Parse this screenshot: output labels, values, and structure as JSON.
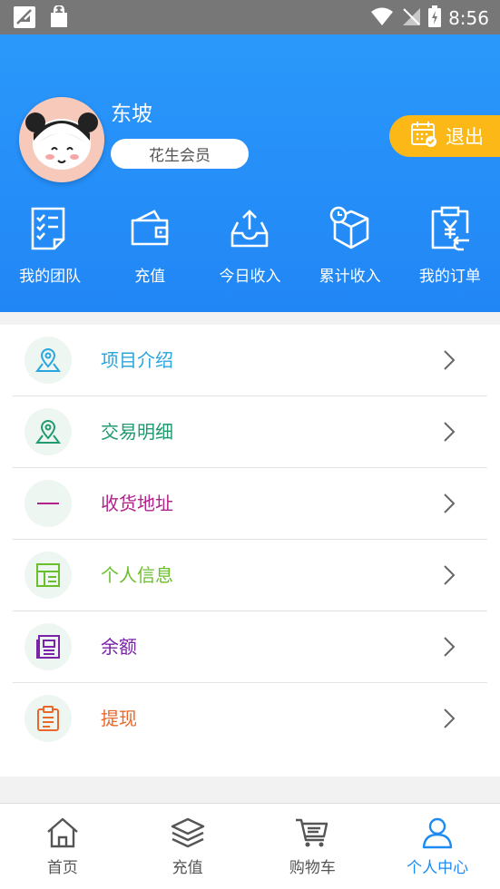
{
  "status_bar": {
    "time": "8:56",
    "icons": [
      "no-sim-image-icon",
      "shopping-bag-icon",
      "wifi-icon",
      "no-signal-icon",
      "battery-charging-icon"
    ]
  },
  "profile": {
    "name": "东坡",
    "member_level": "花生会员",
    "logout_label": "退出"
  },
  "quick_actions": [
    {
      "label": "我的团队",
      "icon": "team-checklist-icon"
    },
    {
      "label": "充值",
      "icon": "wallet-icon"
    },
    {
      "label": "今日收入",
      "icon": "inbox-upload-icon"
    },
    {
      "label": "累计收入",
      "icon": "package-clock-icon"
    },
    {
      "label": "我的订单",
      "icon": "yen-order-icon"
    }
  ],
  "menu": [
    {
      "label": "项目介绍",
      "color": "#2aa6de",
      "icon": "map-pin-icon"
    },
    {
      "label": "交易明细",
      "color": "#1f9b6f",
      "icon": "map-pin-icon"
    },
    {
      "label": "收货地址",
      "color": "#b0238a",
      "icon": "dash-icon"
    },
    {
      "label": "个人信息",
      "color": "#6abf2a",
      "icon": "layout-icon"
    },
    {
      "label": "余额",
      "color": "#7a22a8",
      "icon": "newspaper-icon"
    },
    {
      "label": "提现",
      "color": "#e9672a",
      "icon": "clipboard-icon"
    }
  ],
  "bottom_nav": [
    {
      "label": "首页",
      "icon": "home-icon",
      "active": false
    },
    {
      "label": "充值",
      "icon": "layers-icon",
      "active": false
    },
    {
      "label": "购物车",
      "icon": "cart-icon",
      "active": false
    },
    {
      "label": "个人中心",
      "icon": "user-icon",
      "active": true
    }
  ],
  "colors": {
    "header_blue": "#2186f5",
    "logout_yellow": "#fbb817",
    "active_nav": "#1e8bf2"
  }
}
